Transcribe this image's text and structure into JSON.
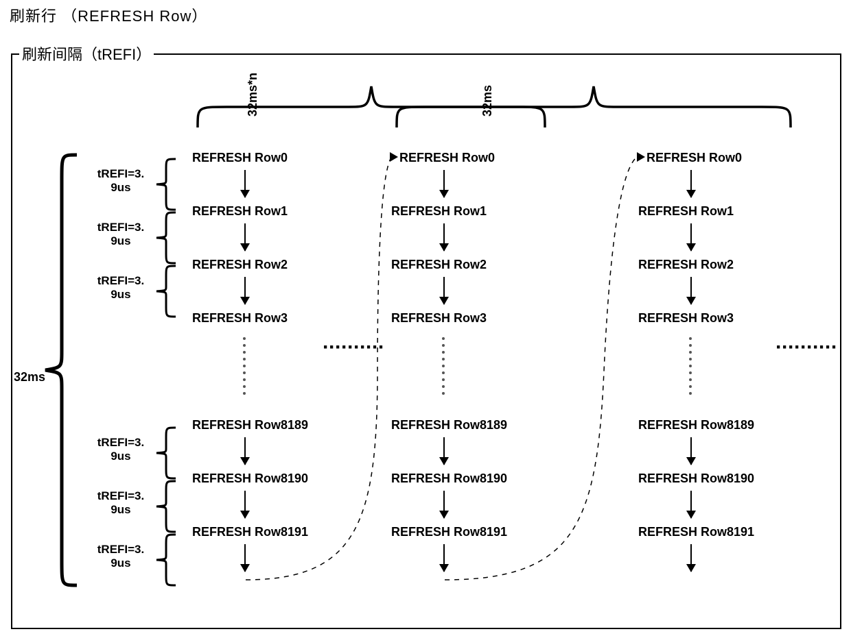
{
  "titles": {
    "refresh_row": "刷新行 （REFRESH Row）",
    "refresh_interval": "刷新间隔（tREFI）"
  },
  "top_braces": {
    "left_label": "32ms*n",
    "right_label": "32ms"
  },
  "left_big_label": "32ms",
  "trefi": {
    "line1": "tREFI=3.",
    "line2": "9us"
  },
  "rows": {
    "r0": "REFRESH Row0",
    "r1": "REFRESH Row1",
    "r2": "REFRESH Row2",
    "r3": "REFRESH Row3",
    "r8189": "REFRESH Row8189",
    "r8190": "REFRESH Row8190",
    "r8191": "REFRESH Row8191"
  },
  "hdots": "··········"
}
